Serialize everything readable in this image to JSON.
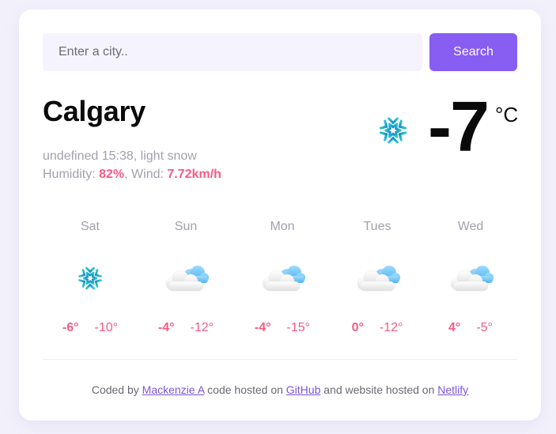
{
  "search": {
    "placeholder": "Enter a city..",
    "value": "",
    "button_label": "Search"
  },
  "current": {
    "city": "Calgary",
    "date_text": "undefined 15:38",
    "separator": ", ",
    "description": "light snow",
    "humidity_label": "Humidity: ",
    "humidity_value": "82%",
    "wind_label": ", Wind: ",
    "wind_value": "7.72km/h",
    "icon": "snowflake-icon",
    "temperature": "-7",
    "unit": "°C"
  },
  "forecast": [
    {
      "day": "Sat",
      "icon": "snowflake-icon",
      "max": "-6°",
      "min": "-10°"
    },
    {
      "day": "Sun",
      "icon": "cloud-icon",
      "max": "-4°",
      "min": "-12°"
    },
    {
      "day": "Mon",
      "icon": "cloud-icon",
      "max": "-4°",
      "min": "-15°"
    },
    {
      "day": "Tues",
      "icon": "cloud-icon",
      "max": "0°",
      "min": "-12°"
    },
    {
      "day": "Wed",
      "icon": "cloud-icon",
      "max": "4°",
      "min": "-5°"
    }
  ],
  "footer": {
    "text_1": "Coded by ",
    "author_link": "Mackenzie A",
    "text_2": " code hosted on ",
    "github_link": "GitHub",
    "text_3": " and website hosted on ",
    "netlify_link": "Netlify"
  },
  "colors": {
    "accent": "#885df1",
    "highlight": "#f65c84",
    "muted_text": "#a3a0ad",
    "input_background": "#f5f3fd",
    "page_background": "#f2f1fb"
  }
}
